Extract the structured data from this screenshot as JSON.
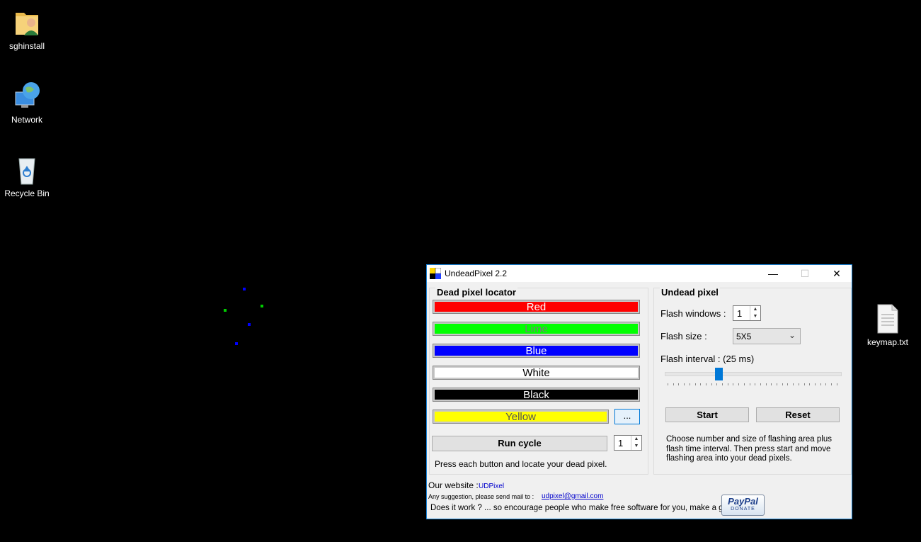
{
  "desktop": {
    "icons": [
      {
        "label": "sghinstall",
        "icon": "user-folder-icon"
      },
      {
        "label": "Network",
        "icon": "network-globe-icon"
      },
      {
        "label": "Recycle Bin",
        "icon": "recycle-bin-icon"
      },
      {
        "label": "keymap.txt",
        "icon": "text-file-icon"
      }
    ]
  },
  "window": {
    "title": "UndeadPixel 2.2",
    "controls": {
      "minimize": "—",
      "maximize": "☐",
      "close": "✕"
    },
    "locator": {
      "title": "Dead pixel locator",
      "colors": [
        {
          "label": "Red",
          "bg": "#ff0000",
          "fg": "#ffffff"
        },
        {
          "label": "Lime",
          "bg": "#00ff00",
          "fg": "#7a7a7a"
        },
        {
          "label": "Blue",
          "bg": "#0000ff",
          "fg": "#ffffff"
        },
        {
          "label": "White",
          "bg": "#ffffff",
          "fg": "#000000"
        },
        {
          "label": "Black",
          "bg": "#000000",
          "fg": "#ffffff"
        },
        {
          "label": "Yellow",
          "bg": "#ffff00",
          "fg": "#555555"
        }
      ],
      "custom_color_button": "...",
      "run_cycle_label": "Run cycle",
      "cycle_count": "1",
      "hint": "Press each button and locate your dead pixel."
    },
    "undead": {
      "title": "Undead pixel",
      "flash_windows_label": "Flash windows :",
      "flash_windows_value": "1",
      "flash_size_label": "Flash size :",
      "flash_size_value": "5X5",
      "flash_interval_label": "Flash interval : (25 ms)",
      "slider_fraction": 0.3,
      "start_label": "Start",
      "reset_label": "Reset",
      "description": "Choose number and size of flashing area plus flash time interval. Then press start and move flashing area into your dead pixels."
    },
    "footer": {
      "website_label": "Our website :",
      "website_link": "UDPixel",
      "mail_label": "Any suggestion, please send mail to :",
      "mail_link": "udpixel@gmail.com",
      "gift_text": "Does it work ? ... so encourage people who make free software for you, make a gift :",
      "paypal_logo": "PayPal",
      "paypal_donate": "DONATE"
    }
  }
}
